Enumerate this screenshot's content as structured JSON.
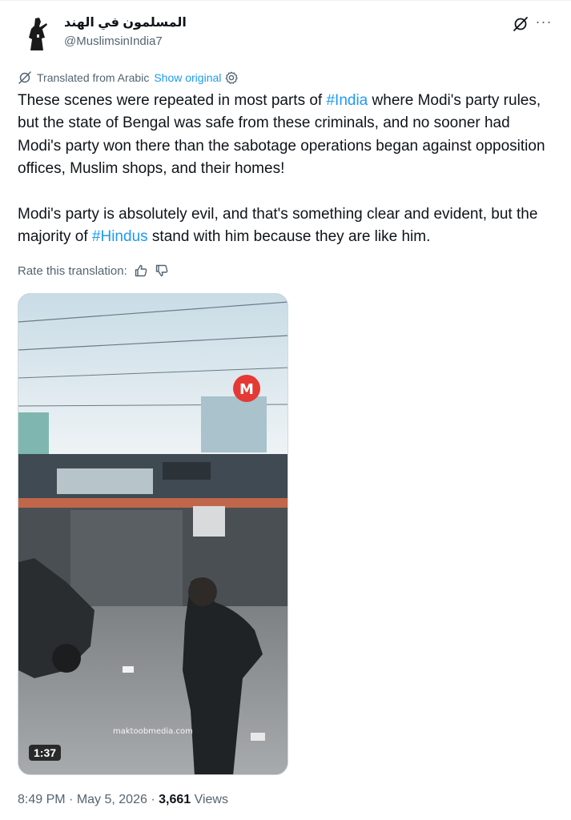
{
  "author": {
    "display_name": "المسلمون في الهند",
    "handle": "@MuslimsinIndia7",
    "avatar_icon": "avatar-silhouette-icon"
  },
  "header_actions": {
    "grok_icon": "grok-icon",
    "more_icon": "more-dots-icon",
    "more_label": "···"
  },
  "translation": {
    "label": "Translated from Arabic",
    "show_original": "Show original",
    "icon": "translate-icon",
    "settings_icon": "gear-icon"
  },
  "tweet": {
    "p1_before": "These scenes were repeated in most parts of ",
    "p1_hashtag": "#India",
    "p1_after": " where Modi's party rules, but the state of Bengal was safe from these criminals, and no sooner had Modi's party won there than the sabotage operations began against opposition offices, Muslim shops, and their homes!",
    "p2_before": "Modi's party is absolutely evil, and that's something clear and evident, but the majority of ",
    "p2_hashtag": "#Hindus",
    "p2_after": " stand with him because they are like him."
  },
  "rate": {
    "label": "Rate this translation:",
    "up_icon": "thumbs-up-icon",
    "down_icon": "thumbs-down-icon"
  },
  "media": {
    "watermark": "maktoobmedia.com",
    "duration": "1:37",
    "logo_letter": "M"
  },
  "meta": {
    "time": "8:49 PM",
    "sep1": " · ",
    "date": "May 5, 2026",
    "sep2": " · ",
    "views_count": "3,661",
    "views_label": " Views"
  }
}
